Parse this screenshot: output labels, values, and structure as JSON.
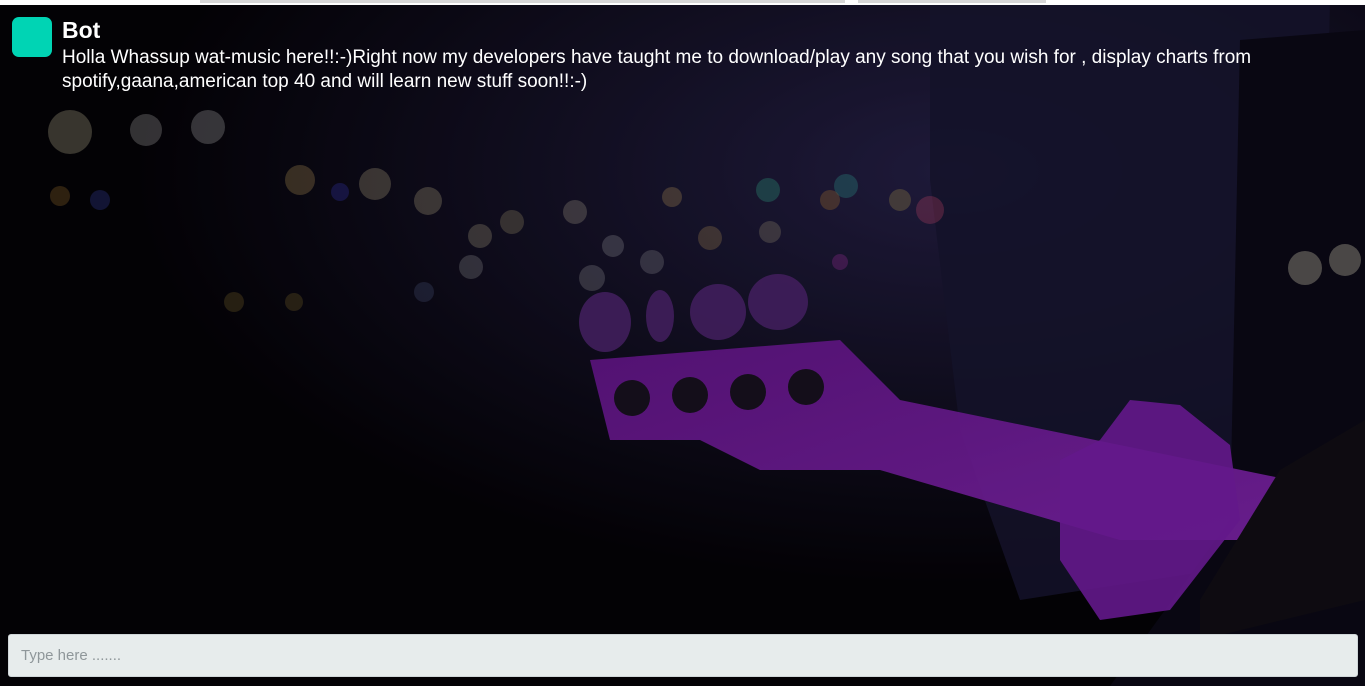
{
  "chat": {
    "messages": [
      {
        "sender": "Bot",
        "text": "Holla Whassup wat-music here!!:-)Right now my developers have taught me to download/play any song that you wish for , display charts from spotify,gaana,american top 40 and will learn new stuff soon!!:-)"
      }
    ]
  },
  "composer": {
    "placeholder": "Type here ......."
  },
  "colors": {
    "avatar": "#00d4b4",
    "guitar": "#8a1fb8",
    "input_bg": "#e7ecec"
  }
}
